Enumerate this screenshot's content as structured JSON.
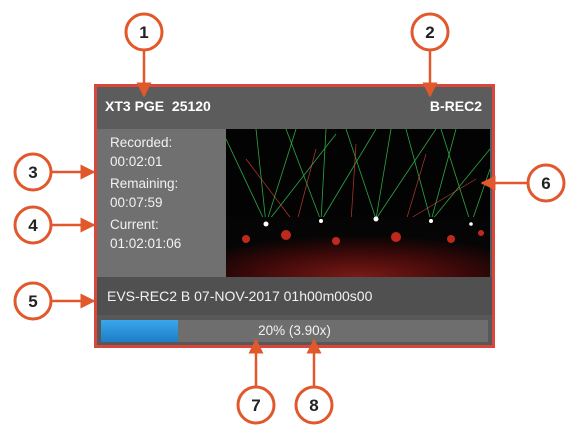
{
  "header": {
    "left_title": "XT3 PGE  25120",
    "right_title": "B-REC2"
  },
  "info": {
    "recorded_label": "Recorded:",
    "recorded_value": "00:02:01",
    "remaining_label": "Remaining:",
    "remaining_value": "00:07:59",
    "current_label": "Current:",
    "current_value": "01:02:01:06"
  },
  "clip": {
    "name": "EVS-REC2 B 07-NOV-2017 01h00m00s00"
  },
  "progress": {
    "percent": 20,
    "text": "20% (3.90x)"
  },
  "callouts": [
    "1",
    "2",
    "3",
    "4",
    "5",
    "6",
    "7",
    "8"
  ],
  "colors": {
    "callout": "#e2582d",
    "panel_border": "#d9473c",
    "progress_fill": "#2d96dd"
  }
}
